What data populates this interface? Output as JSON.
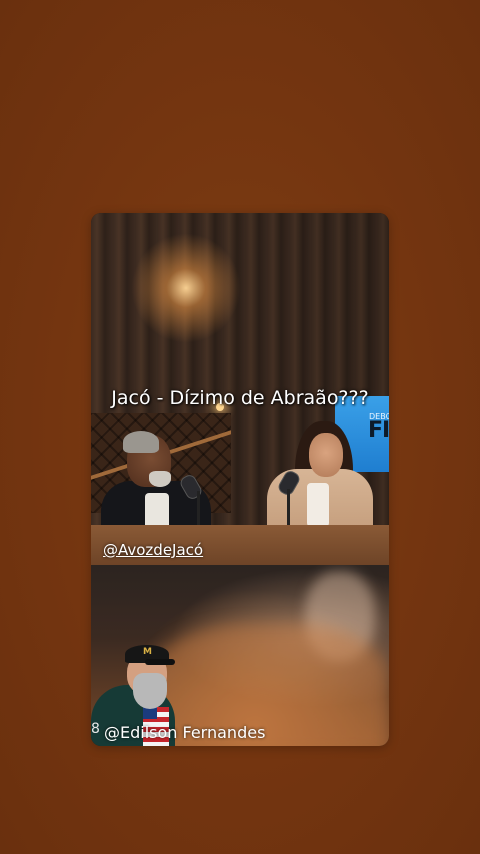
{
  "video": {
    "title_overlay": "Jacó - Dízimo de Abraão???",
    "top_handle": "@AvozdeJacó",
    "bottom_handle": "@Edilson Fernandes",
    "screen_logo_small": "DEBO",
    "screen_logo_big": "FI",
    "cap_logo_text": "M",
    "jersey_text": "8"
  },
  "colors": {
    "background": "#7a3a12",
    "screen_blue": "#2a8de0",
    "text": "#ffffff"
  }
}
